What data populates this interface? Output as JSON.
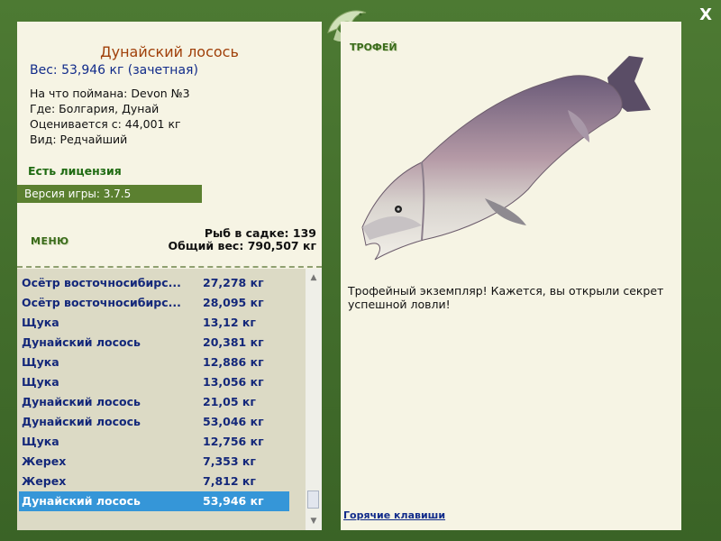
{
  "window": {
    "close_label": "X"
  },
  "fish": {
    "title": "Дунайский лосось",
    "weight": "Вес: 53,946 кг (зачетная)",
    "info": [
      "На что поймана: Devon №3",
      "Где: Болгария, Дунай",
      "Оценивается с: 44,001 кг",
      "Вид: Редчайший"
    ]
  },
  "license": "Есть лицензия",
  "version": "Версия игры: 3.7.5",
  "menu_label": "МЕНЮ",
  "stats": {
    "count": "Рыб в садке: 139",
    "total": "Общий вес: 790,507 кг"
  },
  "catch_list": [
    {
      "name": "Осётр восточносибирс...",
      "weight": "27,278 кг"
    },
    {
      "name": "Осётр восточносибирс...",
      "weight": "28,095 кг"
    },
    {
      "name": "Щука",
      "weight": "13,12 кг"
    },
    {
      "name": "Дунайский лосось",
      "weight": "20,381 кг"
    },
    {
      "name": "Щука",
      "weight": "12,886 кг"
    },
    {
      "name": "Щука",
      "weight": "13,056 кг"
    },
    {
      "name": "Дунайский лосось",
      "weight": "21,05 кг"
    },
    {
      "name": "Дунайский лосось",
      "weight": "53,046 кг"
    },
    {
      "name": "Щука",
      "weight": "12,756 кг"
    },
    {
      "name": "Жерех",
      "weight": "7,353 кг"
    },
    {
      "name": "Жерех",
      "weight": "7,812 кг"
    },
    {
      "name": "Дунайский лосось",
      "weight": "53,946 кг"
    }
  ],
  "selected_index": 11,
  "trophy_label": "ТРОФЕЙ",
  "description": "Трофейный экземпляр! Кажется, вы открыли секрет успешной ловли!",
  "hotkeys_label": "Горячие клавиши",
  "colors": {
    "frame": "#3f6b2a",
    "panel": "#f6f4e4",
    "selected": "#3596d8",
    "link": "#112b8a"
  }
}
